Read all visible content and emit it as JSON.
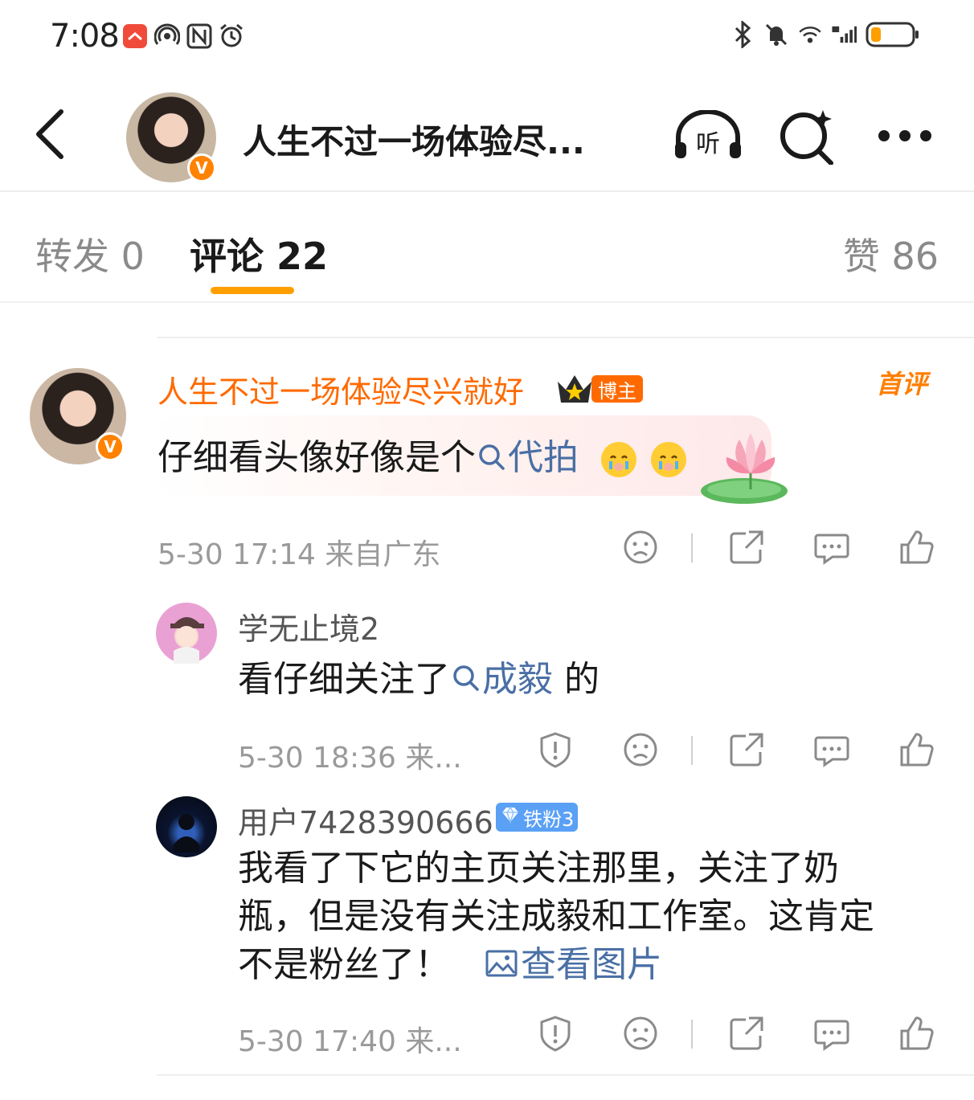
{
  "status_bar": {
    "time": "7:08"
  },
  "nav": {
    "title": "人生不过一场体验尽...",
    "verified_badge": "V"
  },
  "tabs": [
    {
      "label": "转发 0",
      "active": false
    },
    {
      "label": "评论 22",
      "active": true
    },
    {
      "label": "赞 86",
      "active": false
    }
  ],
  "main_comment": {
    "author": "人生不过一场体验尽兴就好",
    "author_badge": "博主",
    "first_badge": "首评",
    "text": "仔细看头像好像是个",
    "link_text": "代拍",
    "meta": "5-30 17:14  来自广东"
  },
  "replies": [
    {
      "author": "学无止境2",
      "text": "看仔细关注了",
      "link_text": "成毅",
      "text_after": " 的",
      "meta": "5-30 18:36  来..."
    },
    {
      "author": "用户7428390666",
      "fan_badge": "铁粉3",
      "text_line1": "我看了下它的主页关注那里，关注了奶",
      "text_line2": "瓶，但是没有关注成毅和工作室。这肯定",
      "text_line3": "不是粉丝了！",
      "image_link": "查看图片",
      "meta": "5-30 17:40  来..."
    }
  ],
  "colors": {
    "accent": "#ff9f00",
    "author_orange": "#ff6a00",
    "link_blue": "#4a6fa5",
    "verified": "#ff8200",
    "fan_blue": "#5aa0f5"
  }
}
